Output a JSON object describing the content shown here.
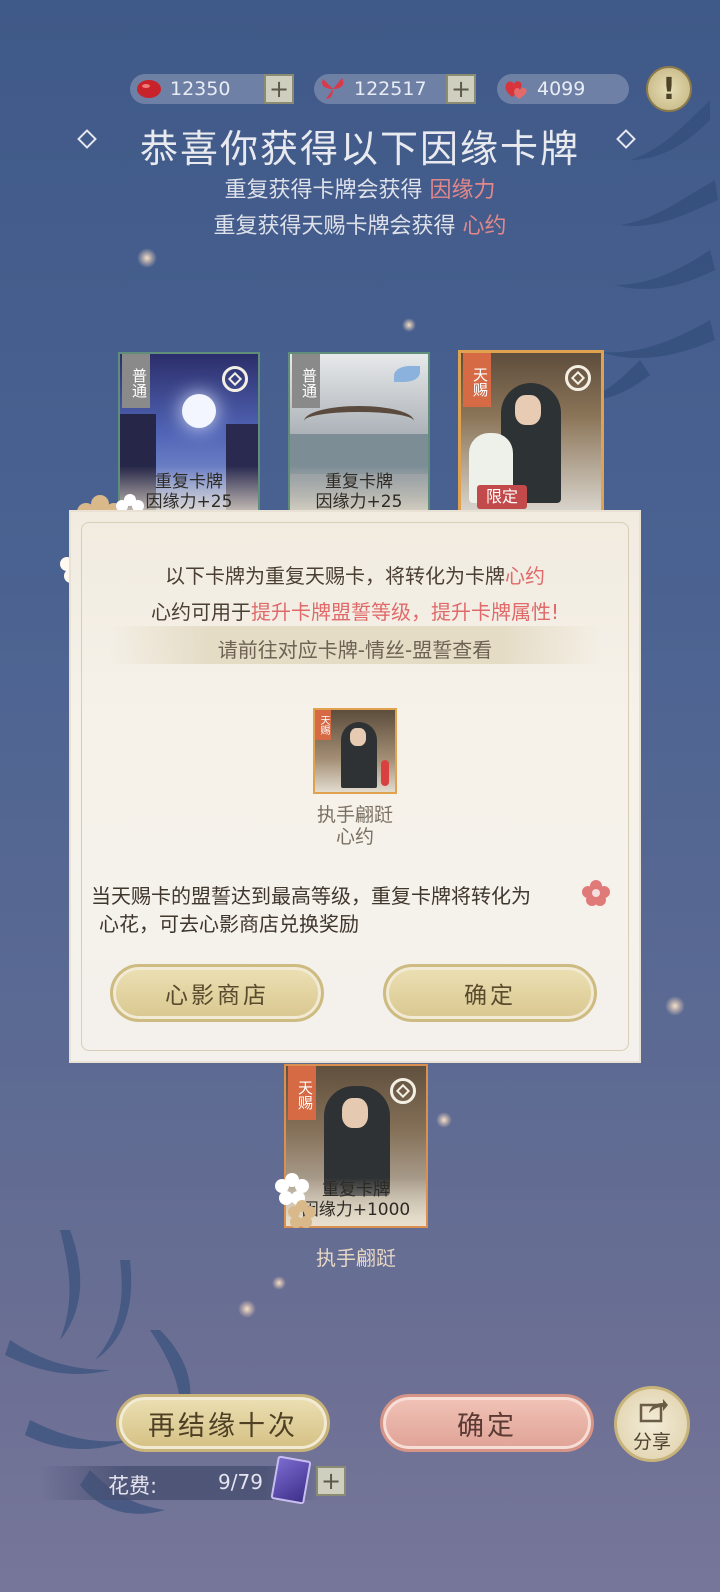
{
  "currency": {
    "red_bean": "12350",
    "butterfly": "122517",
    "heart": "4099",
    "plus": "+"
  },
  "alert": "!",
  "header": {
    "title": "恭喜你获得以下因缘卡牌",
    "line1_prefix": "重复获得卡牌会获得",
    "line1_highlight": "因缘力",
    "line2_prefix": "重复获得天赐卡牌会获得",
    "line2_highlight": "心约"
  },
  "cards": [
    {
      "tag": "普通",
      "line1": "重复卡牌",
      "line2": "因缘力+25"
    },
    {
      "tag": "普通",
      "line1": "重复卡牌",
      "line2": "因缘力+25"
    },
    {
      "tag": "天赐",
      "badge": "限定"
    }
  ],
  "bottom_card": {
    "tag": "天赐",
    "line1": "重复卡牌",
    "line2": "因缘力+1000",
    "name": "执手翩跹"
  },
  "dialog": {
    "line1_prefix": "以下卡牌为重复天赐卡，将转化为卡牌",
    "line1_highlight": "心约",
    "line2_prefix": "心约可用于",
    "line2_highlight": "提升卡牌盟誓等级，提升卡牌属性!",
    "hint": "请前往对应卡牌-情丝-盟誓查看",
    "item_tag": "天赐",
    "item_name": "执手翩跹",
    "item_type": "心约",
    "note_line1": "当天赐卡的盟誓达到最高等级，重复卡牌将转化为",
    "note_line2": "心花，可去心影商店兑换奖励",
    "shop_button": "心影商店",
    "confirm_button": "确定"
  },
  "footer": {
    "again_button": "再结缘十次",
    "confirm_button": "确定",
    "share_button": "分享",
    "cost_label": "花费:",
    "cost_value": "9/79",
    "plus": "+"
  },
  "colors": {
    "accent_red": "#e06a6a",
    "gold_button": "#d9c78f",
    "pink_button": "#e3a9a0"
  }
}
